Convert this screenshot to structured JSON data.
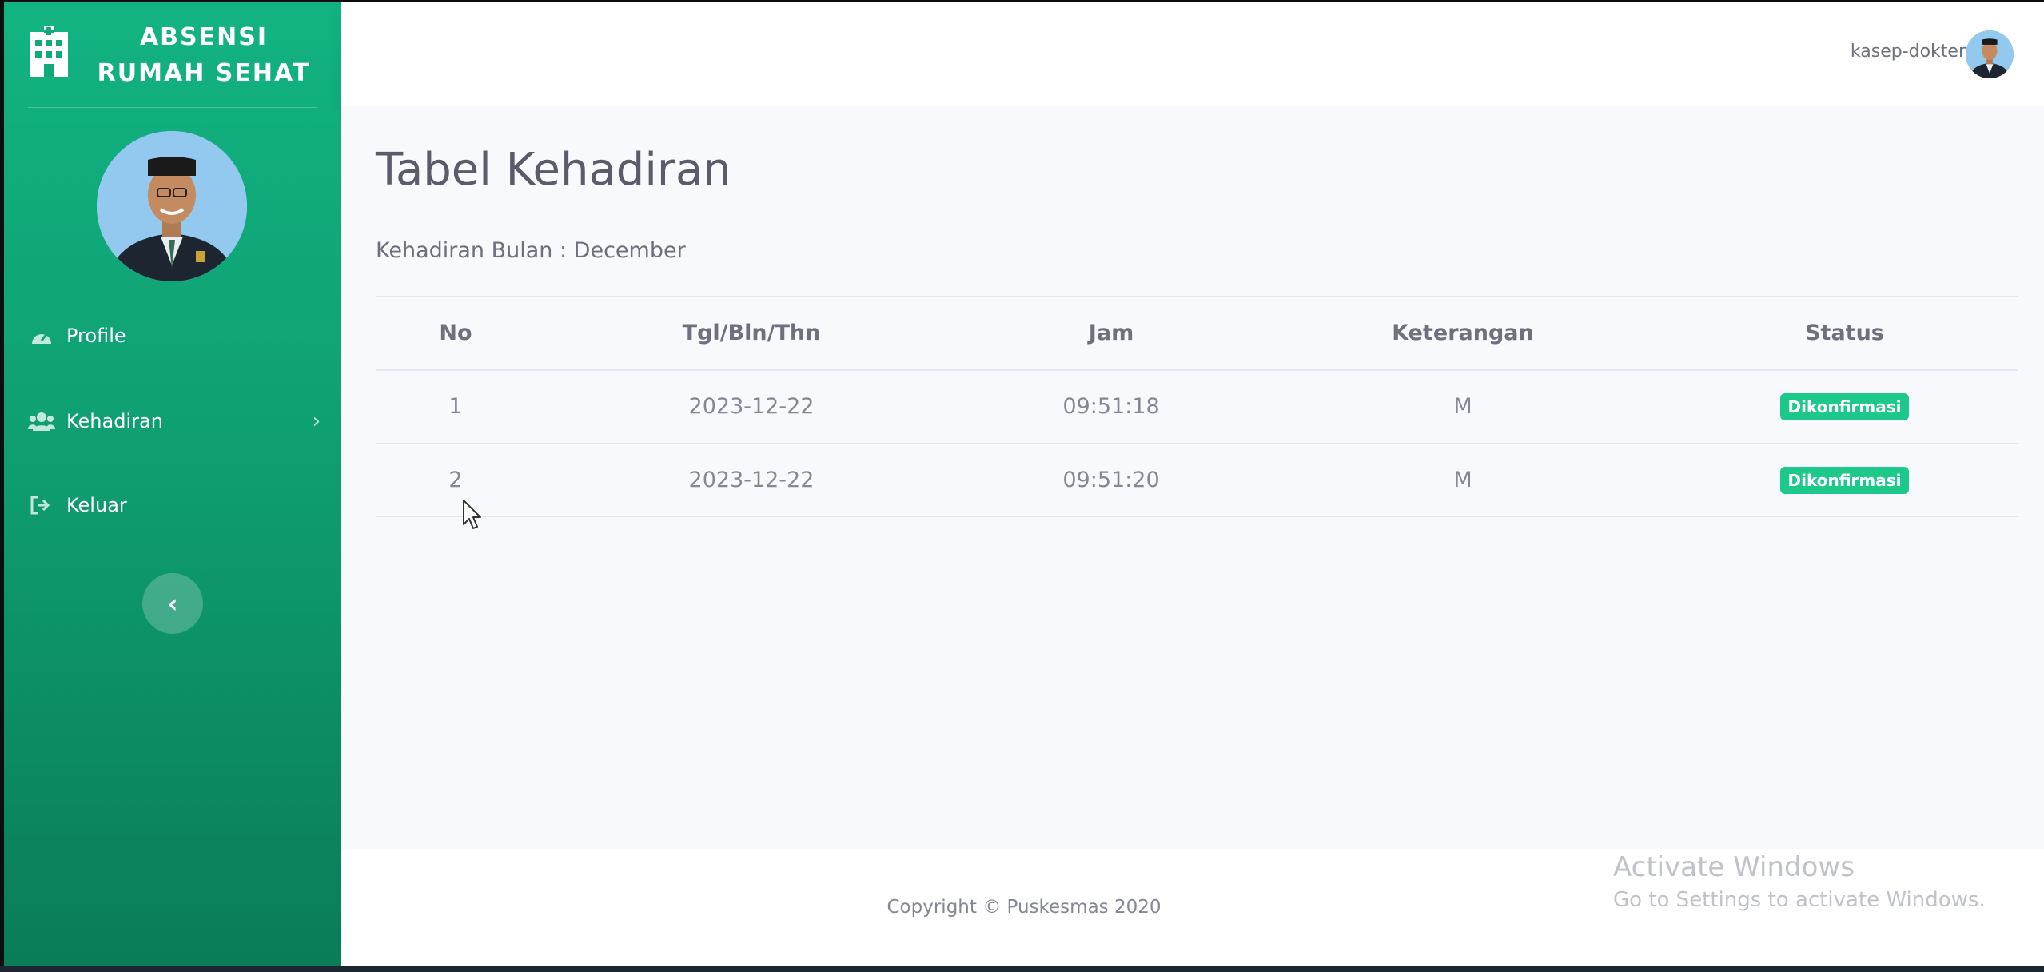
{
  "sidebar": {
    "brand_line1": "ABSENSI",
    "brand_line2": "RUMAH SEHAT",
    "items": [
      {
        "label": "Profile",
        "icon": "dashboard-icon"
      },
      {
        "label": "Kehadiran",
        "icon": "users-icon"
      },
      {
        "label": "Keluar",
        "icon": "sign-out-icon"
      }
    ],
    "collapse_icon": "chevron-left-icon"
  },
  "topbar": {
    "user_name": "kasep-dokter"
  },
  "main": {
    "title": "Tabel Kehadiran",
    "subtitle": "Kehadiran Bulan : December",
    "table": {
      "headers": [
        "No",
        "Tgl/Bln/Thn",
        "Jam",
        "Keterangan",
        "Status"
      ],
      "rows": [
        {
          "no": "1",
          "date": "2023-12-22",
          "time": "09:51:18",
          "ket": "M",
          "status": "Dikonfirmasi"
        },
        {
          "no": "2",
          "date": "2023-12-22",
          "time": "09:51:20",
          "ket": "M",
          "status": "Dikonfirmasi"
        }
      ]
    }
  },
  "footer": {
    "copyright": "Copyright © Puskesmas 2020"
  },
  "watermark": {
    "title": "Activate Windows",
    "subtitle": "Go to Settings to activate Windows."
  },
  "colors": {
    "sidebar_top": "#12b382",
    "sidebar_bottom": "#0a7c58",
    "badge": "#1cc88a",
    "content_bg": "#f8f9fc"
  }
}
